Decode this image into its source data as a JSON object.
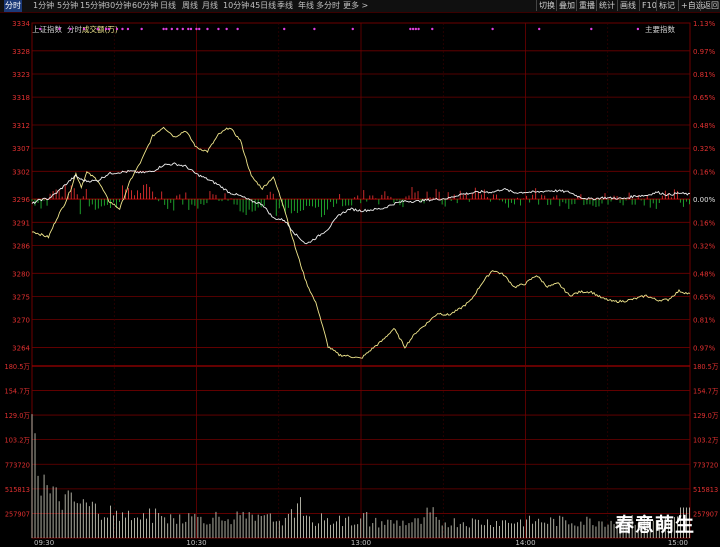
{
  "toolbar": {
    "items": [
      "分时",
      "1分钟",
      "5分钟",
      "15分钟",
      "30分钟",
      "60分钟",
      "日线",
      "周线",
      "月线",
      "10分钟",
      "45日线",
      "季线",
      "年线",
      "多分时",
      "更多 >"
    ],
    "active": 0,
    "right_items": [
      "切换",
      "叠加",
      "重播",
      "统计",
      "画线",
      "F10",
      "标记",
      "+自选",
      "返回"
    ]
  },
  "subheader": {
    "index_name": "上证指数",
    "mode": "分时",
    "volume_label": "成交额(万)",
    "main_index": "主要指数"
  },
  "colors": {
    "grid": "#6e0000",
    "price_line": "#f0f0f0",
    "avg_line": "#f0e68c",
    "up": "#e03030",
    "down": "#20b030",
    "label_left": "#e03030",
    "label_right": "#e03030",
    "axis_blue": "#5080ff",
    "signal_dot": "#e040e0",
    "volume": "#d8d8c8"
  },
  "chart_data": {
    "type": "line",
    "title": "上证指数 分时",
    "y_ticks_left": [
      "3334",
      "3328",
      "3323",
      "3318",
      "3312",
      "3307",
      "3302",
      "3296",
      "3291",
      "3286",
      "3280",
      "3275",
      "3270",
      "3264"
    ],
    "y_ticks_right": [
      "1.13%",
      "0.97%",
      "0.81%",
      "0.65%",
      "0.48%",
      "0.32%",
      "0.16%",
      "0.00%",
      "0.16%",
      "0.32%",
      "0.48%",
      "0.65%",
      "0.81%",
      "0.97%"
    ],
    "ylim": [
      3260,
      3334
    ],
    "prev_close": 3296,
    "x_ticks": [
      "09:30",
      "10:30",
      "13:00",
      "14:00",
      "15:00"
    ],
    "series": [
      {
        "name": "price",
        "x": [
          0,
          3,
          6,
          9,
          12,
          14,
          16,
          18,
          20,
          24,
          28,
          32,
          36,
          40,
          44,
          48,
          52,
          56,
          60,
          64,
          68,
          72,
          76,
          80,
          84,
          88,
          92,
          96,
          100,
          104,
          108,
          112,
          116,
          120,
          124,
          128,
          132,
          136,
          140,
          144,
          148,
          152,
          156,
          160,
          164,
          168,
          172,
          176,
          180,
          184,
          188,
          192,
          196,
          200,
          204,
          208,
          212,
          216,
          220,
          224,
          228,
          232,
          236,
          240
        ],
        "y": [
          3289.1,
          3288.4,
          3287.8,
          3291.8,
          3295.1,
          3297.9,
          3301.5,
          3298.7,
          3301.8,
          3300.1,
          3295.6,
          3293.9,
          3300.2,
          3304.4,
          3309.6,
          3311.6,
          3309.4,
          3310.8,
          3307.1,
          3306.3,
          3309.9,
          3311.5,
          3308.7,
          3300.9,
          3298.3,
          3300.8,
          3294.1,
          3285.6,
          3278.1,
          3272.9,
          3264.2,
          3262.4,
          3262.1,
          3261.6,
          3263.7,
          3265.6,
          3268.1,
          3264.1,
          3267.2,
          3269.2,
          3271.4,
          3271.0,
          3272.3,
          3274.1,
          3277.8,
          3280.7,
          3279.7,
          3277.0,
          3277.8,
          3279.6,
          3277.1,
          3277.8,
          3275.2,
          3276.0,
          3276.0,
          3274.6,
          3273.9,
          3274.0,
          3274.5,
          3275.2,
          3274.2,
          3274.3,
          3276.2,
          3275.5
        ]
      },
      {
        "name": "average",
        "x": [
          0,
          3,
          6,
          9,
          12,
          14,
          16,
          18,
          20,
          24,
          28,
          32,
          36,
          40,
          44,
          48,
          52,
          56,
          60,
          64,
          68,
          72,
          76,
          80,
          84,
          88,
          92,
          96,
          100,
          104,
          108,
          112,
          116,
          120,
          124,
          128,
          132,
          136,
          140,
          144,
          148,
          152,
          156,
          160,
          164,
          168,
          172,
          176,
          180,
          184,
          188,
          192,
          196,
          200,
          204,
          208,
          212,
          216,
          220,
          224,
          228,
          232,
          236,
          240
        ],
        "y": [
          3295.0,
          3295.9,
          3296.1,
          3297.4,
          3299.0,
          3300.1,
          3301.0,
          3300.2,
          3299.9,
          3300.0,
          3301.5,
          3301.8,
          3302.0,
          3301.7,
          3302.0,
          3303.4,
          3303.6,
          3303.1,
          3301.4,
          3300.3,
          3299.1,
          3297.4,
          3296.7,
          3295.6,
          3294.9,
          3291.9,
          3291.5,
          3288.5,
          3286.3,
          3287.8,
          3289.6,
          3292.6,
          3293.9,
          3293.5,
          3293.7,
          3294.0,
          3295.0,
          3295.6,
          3295.5,
          3295.8,
          3296.0,
          3296.2,
          3297.0,
          3297.3,
          3297.6,
          3297.5,
          3298.2,
          3297.4,
          3297.5,
          3297.5,
          3297.8,
          3297.8,
          3297.5,
          3296.4,
          3296.0,
          3296.3,
          3296.2,
          3296.1,
          3296.7,
          3296.8,
          3297.5,
          3296.9,
          3297.3,
          3297.0
        ]
      }
    ],
    "volume": {
      "ylabel": "成交额(万)",
      "y_ticks_left": [
        "180.5万",
        "154.7万",
        "129.0万",
        "103.2万",
        "773720",
        "515813",
        "257907"
      ],
      "y_ticks_right": [
        "180.5万",
        "154.7万",
        "129.0万",
        "103.2万",
        "773720",
        "515813",
        "257907"
      ],
      "ylim": [
        0,
        1805000
      ]
    },
    "grid": true
  },
  "watermark": "春意萌生"
}
